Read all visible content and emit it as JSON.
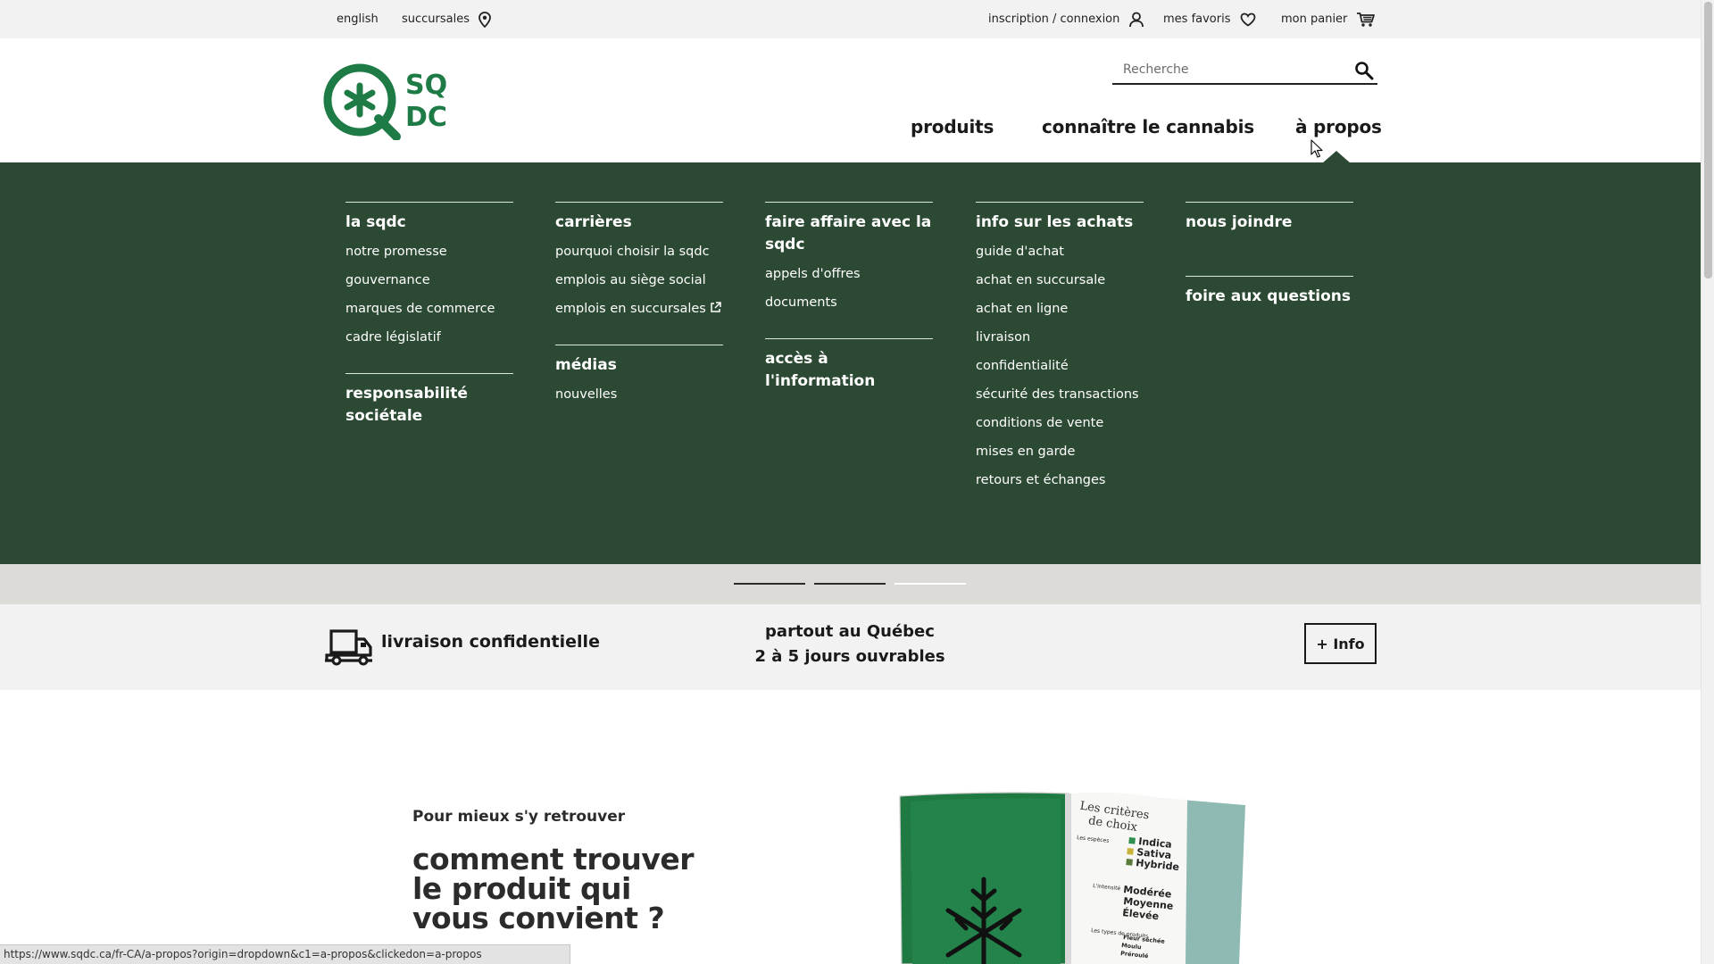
{
  "colors": {
    "brand_green": "#2c4a33",
    "logo_green": "#1e7b45",
    "text_dark": "#1a1a1a",
    "utility_bg": "#f2f2f2",
    "indicator_bg": "#dcdbd7"
  },
  "utility_bar": {
    "language": "english",
    "stores": "succursales",
    "stores_icon": "map-pin-icon",
    "login": "inscription / connexion",
    "login_icon": "user-icon",
    "favorites": "mes favoris",
    "favorites_icon": "heart-icon",
    "cart": "mon panier",
    "cart_icon": "cart-icon"
  },
  "header": {
    "logo_text_top": "SQ",
    "logo_text_bottom": "DC",
    "search_placeholder": "Recherche",
    "search_icon": "search-icon",
    "nav": [
      "produits",
      "connaître le cannabis",
      "à propos"
    ]
  },
  "dropdown": {
    "columns": [
      {
        "sections": [
          {
            "heading": "la sqdc",
            "links": [
              "notre promesse",
              "gouvernance",
              "marques de commerce",
              "cadre législatif"
            ]
          },
          {
            "heading": "responsabilité sociétale",
            "links": []
          }
        ]
      },
      {
        "sections": [
          {
            "heading": "carrières",
            "links": [
              "pourquoi choisir la sqdc",
              "emplois au siège social",
              "emplois en succursales"
            ]
          },
          {
            "heading": "médias",
            "links": [
              "nouvelles"
            ]
          }
        ]
      },
      {
        "sections": [
          {
            "heading": "faire affaire avec la sqdc",
            "links": [
              "appels d'offres",
              "documents"
            ]
          },
          {
            "heading": "accès à l'information",
            "links": []
          }
        ]
      },
      {
        "sections": [
          {
            "heading": "info sur les achats",
            "links": [
              "guide d'achat",
              "achat en succursale",
              "achat en ligne",
              "livraison",
              "confidentialité",
              "sécurité des transactions",
              "conditions de vente",
              "mises en garde",
              "retours et échanges"
            ]
          }
        ]
      },
      {
        "sections": [
          {
            "heading": "nous joindre",
            "links": []
          },
          {
            "heading": "foire aux questions",
            "links": []
          }
        ]
      }
    ],
    "external_link_icon": "external-link-icon"
  },
  "carousel": {
    "slide_count": 3,
    "active_index": 2
  },
  "delivery": {
    "icon": "delivery-truck-icon",
    "title": "livraison confidentielle",
    "line1": "partout au Québec",
    "line2": "2 à 5 jours ouvrables",
    "button": "+ Info"
  },
  "promo": {
    "kicker": "Pour mieux s'y retrouver",
    "title": "comment trouver le produit qui vous convient ?",
    "magazine_heading_1": "Les critères",
    "magazine_heading_2": "de choix",
    "magazine_label_species": "Les espèces",
    "magazine_species": [
      "Indica",
      "Sativa",
      "Hybride"
    ],
    "magazine_label_intensity": "L'intensité",
    "magazine_intensity": [
      "Modérée",
      "Moyenne",
      "Élevée"
    ],
    "magazine_label_types": "Les types de produits",
    "magazine_types": [
      "Fleur séchée",
      "Moulu",
      "Préroulé"
    ]
  },
  "status_bar": {
    "url": "https://www.sqdc.ca/fr-CA/a-propos?origin=dropdown&c1=a-propos&clickedon=a-propos"
  }
}
